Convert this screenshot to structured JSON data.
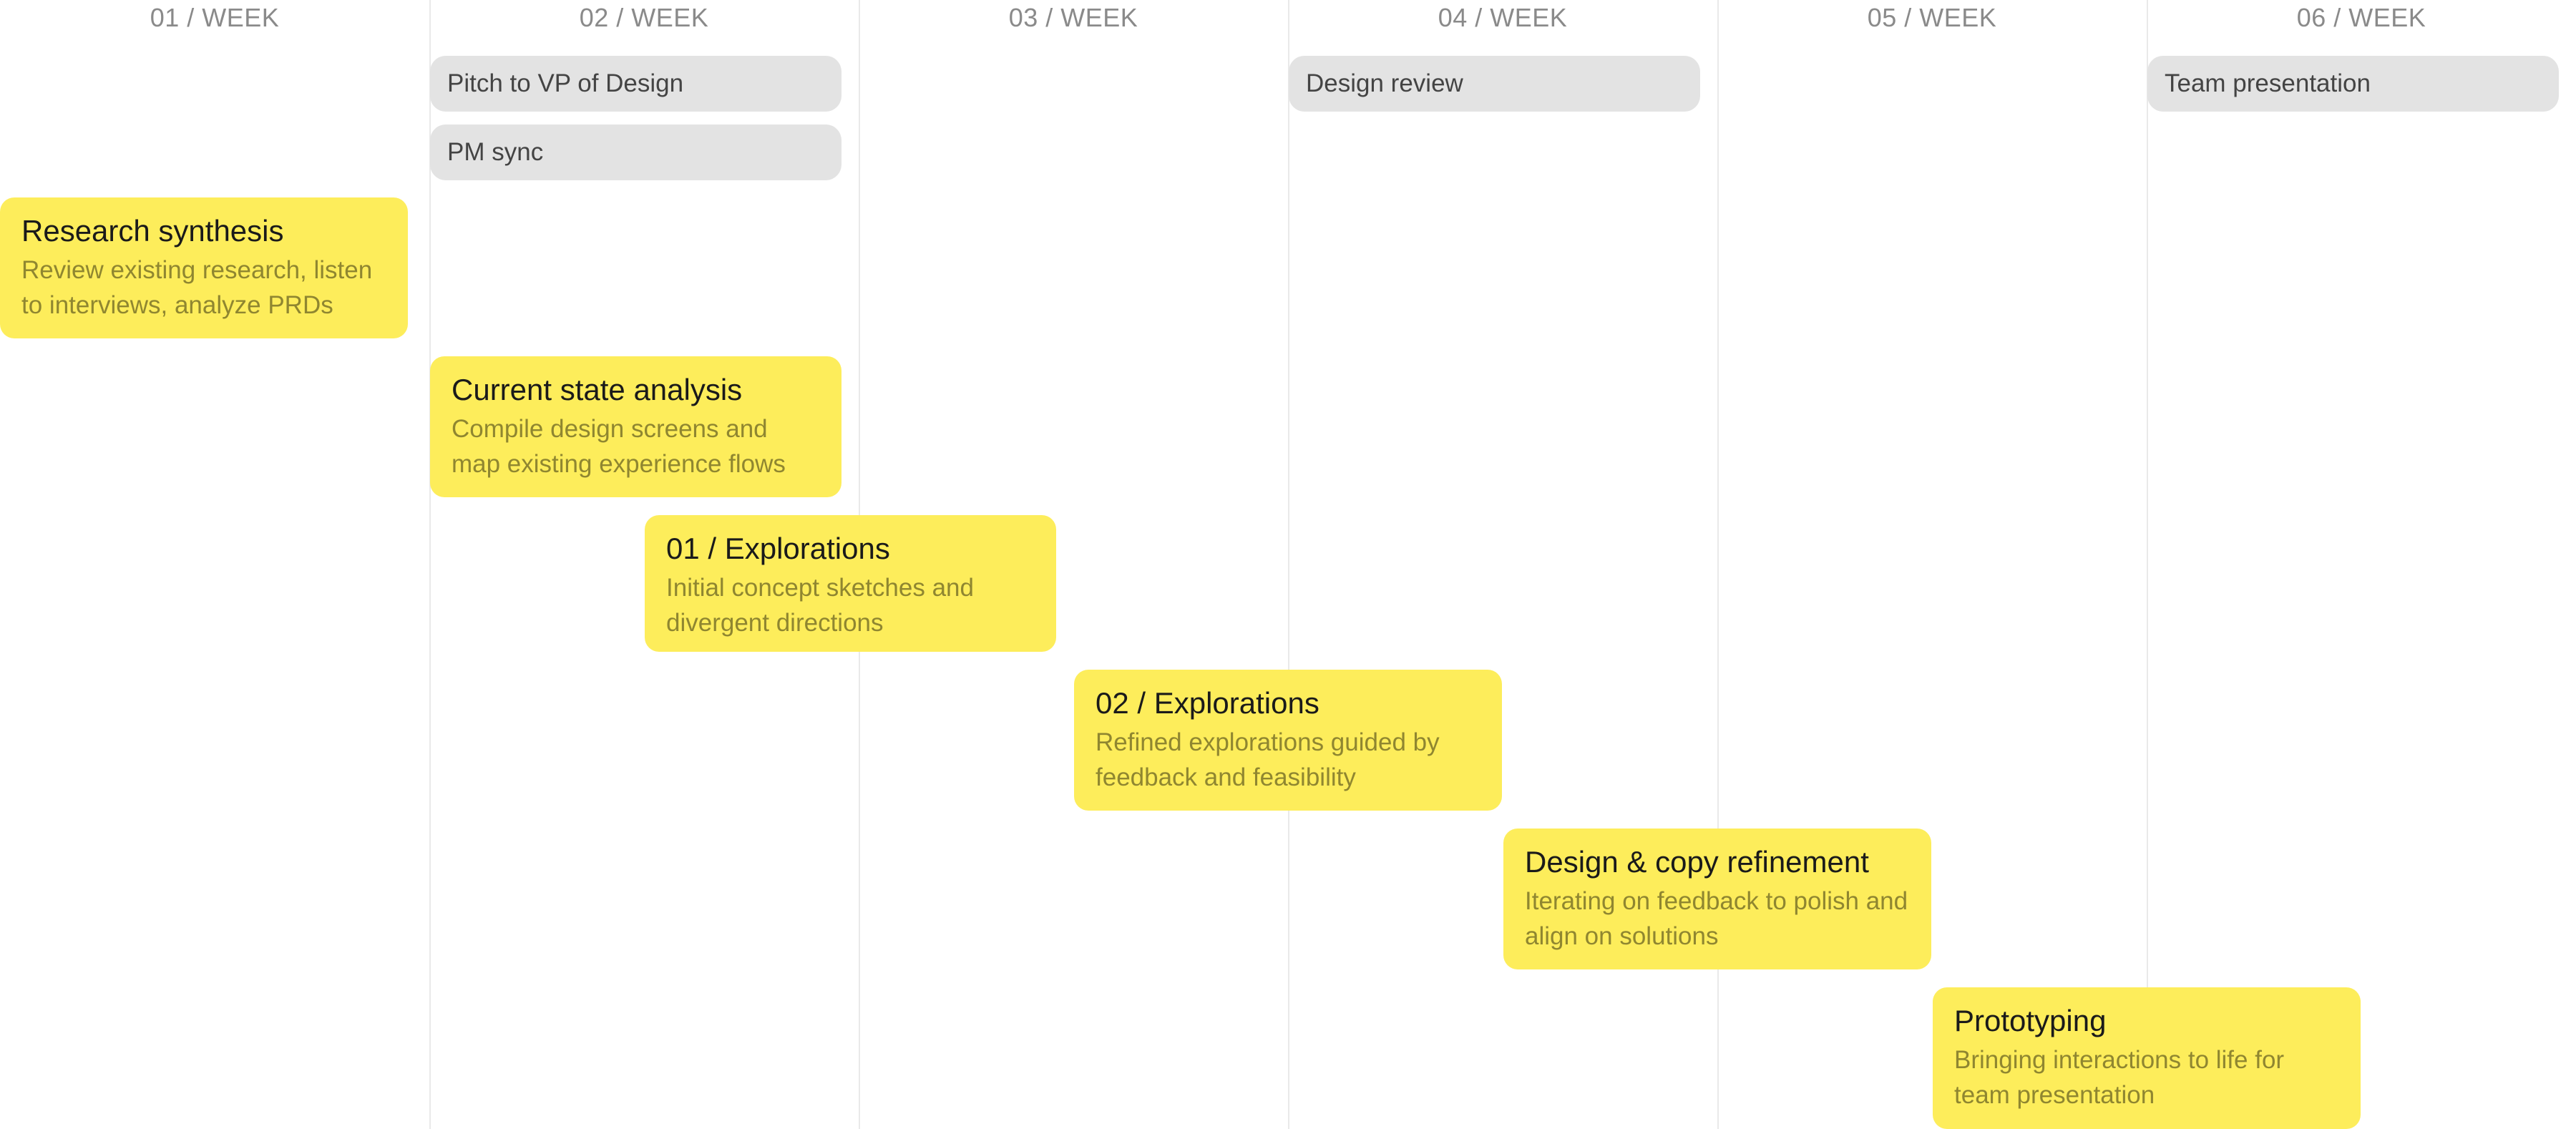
{
  "weeks": [
    {
      "label": "01 / WEEK"
    },
    {
      "label": "02 / WEEK"
    },
    {
      "label": "03 / WEEK"
    },
    {
      "label": "04 / WEEK"
    },
    {
      "label": "05 / WEEK"
    },
    {
      "label": "06 / WEEK"
    }
  ],
  "milestones": [
    {
      "label": "Pitch to VP of Design"
    },
    {
      "label": "PM sync"
    },
    {
      "label": "Design review"
    },
    {
      "label": "Team presentation"
    }
  ],
  "tasks": [
    {
      "title": "Research synthesis",
      "description": "Review existing research, listen to interviews, analyze PRDs"
    },
    {
      "title": "Current state analysis",
      "description": "Compile design screens and map existing experience flows"
    },
    {
      "title": "01 / Explorations",
      "description": "Initial concept sketches and divergent directions"
    },
    {
      "title": "02 / Explorations",
      "description": "Refined explorations guided by feedback and feasibility"
    },
    {
      "title": "Design & copy refinement",
      "description": "Iterating on feedback to polish and align on solutions"
    },
    {
      "title": "Prototyping",
      "description": "Bringing interactions to life for team presentation"
    }
  ],
  "colors": {
    "task_card": "#fded5b",
    "milestone_pill": "#e3e3e3",
    "grid_line": "#e9e9e9",
    "header_text": "#8a8a8a"
  }
}
